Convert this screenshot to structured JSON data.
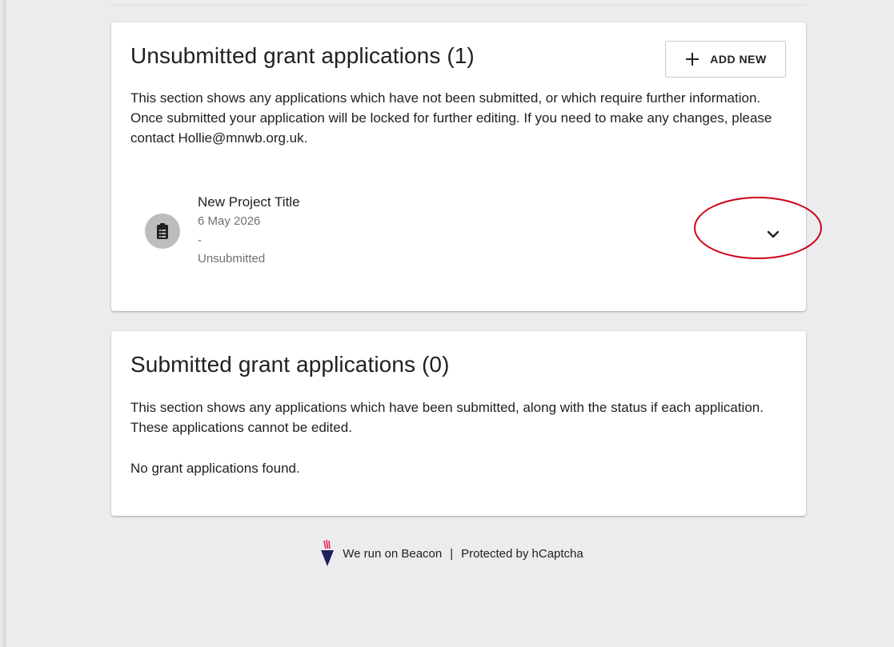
{
  "unsubmitted": {
    "title": "Unsubmitted grant applications (1)",
    "add_new_label": "ADD NEW",
    "description": "This section shows any applications which have not been submitted, or which require further information. Once submitted your application will be locked for further editing. If you need to make any changes, please contact Hollie@mnwb.org.uk.",
    "items": [
      {
        "title": "New Project Title",
        "date": "6 May 2026",
        "dash": "-",
        "status": "Unsubmitted",
        "icon": "clipboard-list-icon"
      }
    ]
  },
  "submitted": {
    "title": "Submitted grant applications (0)",
    "description": "This section shows any applications which have been submitted, along with the status if each application. These applications cannot be edited.",
    "empty_text": "No grant applications found."
  },
  "footer": {
    "beacon_text": "We run on Beacon",
    "separator": "|",
    "captcha_text": "Protected by hCaptcha"
  },
  "colors": {
    "page_background": "#e9e9ec",
    "card_background": "#ffffff",
    "annotation": "#d0021b",
    "avatar_background": "#bdbdbd",
    "beacon_navy": "#1a1f5c",
    "beacon_flame": "#e0245e"
  }
}
